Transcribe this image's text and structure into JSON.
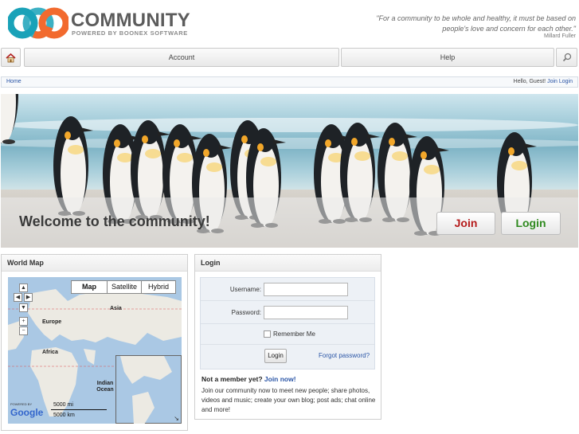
{
  "header": {
    "brand_title": "COMMUNITY",
    "brand_subtitle": "POWERED BY BOONEX SOFTWARE",
    "quote": "\"For a community to be whole and healthy, it must be based on people's love and concern for each other.\"",
    "quote_author": "Millard Fuller"
  },
  "nav": {
    "account": "Account",
    "help": "Help"
  },
  "breadcrumb": {
    "home": "Home",
    "greeting": "Hello, Guest!",
    "join": "Join",
    "login": "Login"
  },
  "hero": {
    "title": "Welcome to the community!",
    "join_label": "Join",
    "login_label": "Login"
  },
  "world_map": {
    "title": "World Map",
    "types": [
      "Map",
      "Satellite",
      "Hybrid"
    ],
    "labels": {
      "asia": "Asia",
      "europe": "Europe",
      "africa": "Africa",
      "indian_ocean": "Indian Ocean"
    },
    "scale_mi": "5000 mi",
    "scale_km": "5000 km",
    "powered_by": "POWERED BY",
    "google": "Google"
  },
  "login": {
    "title": "Login",
    "username_label": "Username:",
    "password_label": "Password:",
    "remember_label": "Remember Me",
    "button_label": "Login",
    "forgot_label": "Forgot password?",
    "not_member": "Not a member yet?",
    "join_now": "Join now!",
    "join_text": "Join our community now to meet new people; share photos, videos and music; create your own blog; post ads; chat online and more!"
  },
  "colors": {
    "link": "#2a55a6",
    "join": "#b51a1a",
    "login": "#2f8a1f",
    "logo_teal": "#1aa2b8",
    "logo_orange": "#f26a2e"
  }
}
